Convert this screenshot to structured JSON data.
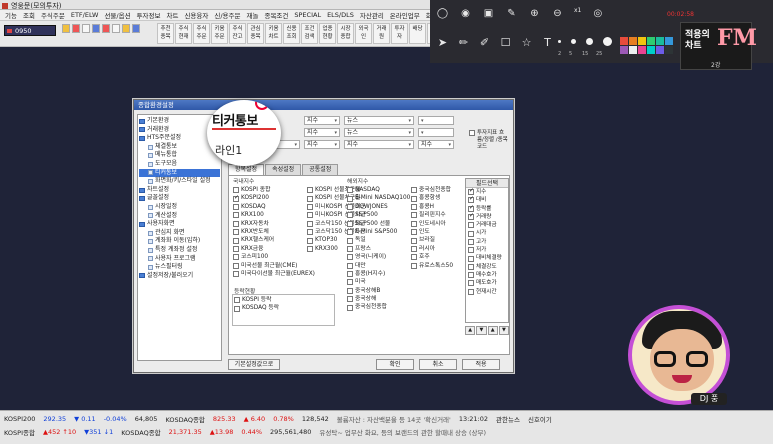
{
  "window": {
    "title": "영웅문(모의투자)"
  },
  "menu": [
    "기능",
    "조회",
    "주식주문",
    "ETF/ELW",
    "선물/옵션",
    "투자정보",
    "차트",
    "신용융자",
    "신/용주문",
    "재놀",
    "종목조건",
    "SPECIAL",
    "ELS/DLS",
    "자산관리",
    "온라인업무",
    "회원"
  ],
  "toolbar": {
    "account": "0950",
    "buttons": [
      "추천종목",
      "주식현재",
      "주식주문",
      "키움주문",
      "주식잔고",
      "관심종목",
      "키움차트",
      "신용조회",
      "조건검색",
      "업종현황",
      "시장종합",
      "외국인",
      "거래원",
      "투자자",
      "배당",
      "신규상장",
      "계좌",
      "종합"
    ]
  },
  "dialog": {
    "title": "종합환경설정",
    "tree": [
      {
        "label": "기본환경",
        "level": 0
      },
      {
        "label": "거래환경",
        "level": 0
      },
      {
        "label": "HTS주문설정",
        "level": 0
      },
      {
        "label": "체결통보",
        "level": 1
      },
      {
        "label": "메뉴통합",
        "level": 1
      },
      {
        "label": "도구모음",
        "level": 1
      },
      {
        "label": "티커통보",
        "level": 1,
        "selected": true
      },
      {
        "label": "화면화/키/스타일 설정",
        "level": 1
      },
      {
        "label": "차트설정",
        "level": 0
      },
      {
        "label": "글꼴설정",
        "level": 0
      },
      {
        "label": "시장일정",
        "level": 1
      },
      {
        "label": "계산설정",
        "level": 1
      },
      {
        "label": "사용자화면",
        "level": 0
      },
      {
        "label": "관심지 화면",
        "level": 1
      },
      {
        "label": "계좌화 이동(입하)",
        "level": 1
      },
      {
        "label": "특정 계좌정 설정",
        "level": 1
      },
      {
        "label": "사용자 프로그램",
        "level": 1
      },
      {
        "label": "뉴스필터링",
        "level": 1
      },
      {
        "label": "설정저장/불러오기",
        "level": 0
      }
    ],
    "top_rows": [
      [
        "",
        "지수",
        "뉴스",
        "",
        ""
      ],
      [
        "",
        "지수",
        "뉴스",
        ""
      ],
      [
        "라인1 현재가/등락",
        "지수",
        "지수",
        "지수"
      ]
    ],
    "side_option": "투자지표 흐름/정렬 /종목코드",
    "tabs": [
      "항목설정",
      "속성설정",
      "공통설정"
    ],
    "col1_header": "국내지수",
    "col1": [
      {
        "label": "KOSPI 종합",
        "on": false
      },
      {
        "label": "KOSPI200",
        "on": true
      },
      {
        "label": "KOSDAQ",
        "on": false
      },
      {
        "label": "KRX100",
        "on": false
      },
      {
        "label": "KRX자동차",
        "on": false
      },
      {
        "label": "KRX반도체",
        "on": false
      },
      {
        "label": "KRX헬스케어",
        "on": false
      },
      {
        "label": "KRX금융",
        "on": false
      },
      {
        "label": "코스피100",
        "on": false
      },
      {
        "label": "미국선물 최근월(CME)",
        "on": false
      },
      {
        "label": "미국다이선물 최근월(EUREX)",
        "on": false
      }
    ],
    "col2": [
      {
        "label": "KOSPI 선물최근월",
        "on": false
      },
      {
        "label": "KOSPI 선물차근월",
        "on": false
      },
      {
        "label": "미니KOSPI 선물최근",
        "on": false
      },
      {
        "label": "미니KOSPI 선물차근",
        "on": false
      },
      {
        "label": "코스닥150 선물최근",
        "on": false
      },
      {
        "label": "코스닥150 선물차근",
        "on": false
      },
      {
        "label": "KTOP30",
        "on": false
      },
      {
        "label": "KRX300",
        "on": false
      }
    ],
    "sub_header": "등락현황",
    "sub": [
      {
        "label": "KOSPI 등락",
        "on": false
      },
      {
        "label": "KOSDAQ 등락",
        "on": false
      }
    ],
    "col3_header": "해외지수",
    "col3": [
      {
        "label": "NASDAQ",
        "on": false
      },
      {
        "label": "E-Mini NASDAQ100",
        "on": false
      },
      {
        "label": "DOWJONES",
        "on": false
      },
      {
        "label": "S&P500",
        "on": false
      },
      {
        "label": "S&P500 선물",
        "on": false
      },
      {
        "label": "E-Mini S&P500",
        "on": false
      },
      {
        "label": "독일",
        "on": false
      },
      {
        "label": "프랑스",
        "on": false
      },
      {
        "label": "영국(니케이)",
        "on": false
      },
      {
        "label": "대만",
        "on": false
      },
      {
        "label": "홍콩(H지수)",
        "on": false
      },
      {
        "label": "미국",
        "on": false
      },
      {
        "label": "중국상해B",
        "on": false
      },
      {
        "label": "중국상해",
        "on": false
      },
      {
        "label": "중국심천종합",
        "on": false
      }
    ],
    "col4": [
      {
        "label": "중국심천종합",
        "on": false
      },
      {
        "label": "홍콩항셍",
        "on": false
      },
      {
        "label": "홍콩H",
        "on": false
      },
      {
        "label": "필리핀지수",
        "on": false
      },
      {
        "label": "인도네시아",
        "on": false
      },
      {
        "label": "인도",
        "on": false
      },
      {
        "label": "브라질",
        "on": false
      },
      {
        "label": "러시아",
        "on": false
      },
      {
        "label": "호주",
        "on": false
      },
      {
        "label": "유로스톡스50",
        "on": false
      }
    ],
    "field_header": "필드선택",
    "fields": [
      {
        "label": "지수",
        "on": true
      },
      {
        "label": "대비",
        "on": true
      },
      {
        "label": "등락률",
        "on": true
      },
      {
        "label": "거래량",
        "on": true
      },
      {
        "label": "거래대금",
        "on": false
      },
      {
        "label": "시가",
        "on": false
      },
      {
        "label": "고가",
        "on": false
      },
      {
        "label": "저가",
        "on": false
      },
      {
        "label": "대비체결량",
        "on": false
      },
      {
        "label": "체결강도",
        "on": false
      },
      {
        "label": "매수호가",
        "on": false
      },
      {
        "label": "매도호가",
        "on": false
      },
      {
        "label": "현재시간",
        "on": false
      }
    ],
    "field_arrows": [
      "▲",
      "▼",
      "▲",
      "▼"
    ],
    "buttons": {
      "default": "기본설정값으로",
      "ok": "확인",
      "cancel": "취소",
      "apply": "적용"
    },
    "callout": {
      "big": "티커통보",
      "small": "라인1"
    }
  },
  "annotation_toolbar": {
    "icons_row1": [
      "circle-icon",
      "record-icon",
      "screen-icon",
      "pen-icon",
      "zoom-in-icon",
      "zoom-out-icon",
      "eye-icon"
    ],
    "zoom_label": "x1",
    "time": "00:02:58",
    "icons_row2": [
      "pointer-icon",
      "pencil-icon",
      "highlighter-icon",
      "rectangle-icon",
      "star-icon",
      "text-icon"
    ],
    "sizes": [
      "2",
      "5",
      "15",
      "25"
    ],
    "palette": [
      "#e74c3c",
      "#e67e22",
      "#f1c40f",
      "#2ecc71",
      "#1abc9c",
      "#3498db",
      "#9b59b6",
      "#ecf0f1",
      "#e84393",
      "#00cec9",
      "#6c5ce7",
      "#2d3436"
    ]
  },
  "brand": {
    "line1": "적용의",
    "line2": "차트",
    "fm": "FM",
    "episode": "2강"
  },
  "presenter": {
    "tag": "DJ 풍"
  },
  "status": {
    "row1": [
      {
        "text": "KOSPI200",
        "cls": ""
      },
      {
        "text": "292.35",
        "cls": "down"
      },
      {
        "text": "▼ 0.11",
        "cls": "down"
      },
      {
        "text": "-0.04%",
        "cls": "down"
      },
      {
        "text": "64,805",
        "cls": ""
      },
      {
        "text": "KOSDAQ종합",
        "cls": ""
      },
      {
        "text": "825.33",
        "cls": "up"
      },
      {
        "text": "▲ 6.40",
        "cls": "up"
      },
      {
        "text": "0.78%",
        "cls": "up"
      },
      {
        "text": "128,542",
        "cls": ""
      },
      {
        "text": "볼륨자산 : 자산백분율 등 14곳 '확신거래'",
        "cls": "mid"
      },
      {
        "text": "13:21:02",
        "cls": ""
      },
      {
        "text": "관한뉴스",
        "cls": ""
      },
      {
        "text": "신호이기",
        "cls": ""
      }
    ],
    "row2": [
      {
        "text": "KOSPI종합",
        "cls": ""
      },
      {
        "text": "▲452 ↑10",
        "cls": "up"
      },
      {
        "text": "▼351 ↓1",
        "cls": "down"
      },
      {
        "text": "KOSDAQ종합",
        "cls": ""
      },
      {
        "text": "21,371.35",
        "cls": "up"
      },
      {
        "text": "▲13.98",
        "cls": "up"
      },
      {
        "text": "0.44%",
        "cls": "up"
      },
      {
        "text": "295,561,480",
        "cls": ""
      },
      {
        "text": "유성탁~ 업무산 화요, 등의 보랜드의 관한 할때내 상승 (상부)",
        "cls": "mid"
      }
    ]
  }
}
